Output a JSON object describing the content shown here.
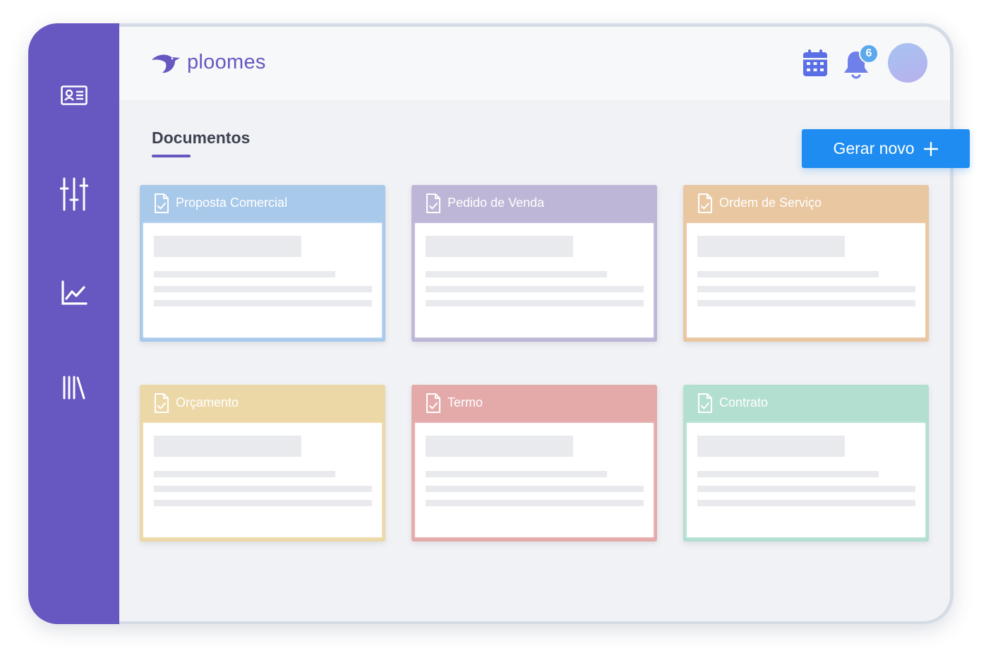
{
  "app": {
    "logo_text": "ploomes"
  },
  "header": {
    "notification_count": "6"
  },
  "page": {
    "title": "Documentos"
  },
  "actions": {
    "new_label": "Gerar novo",
    "new_icon": "plus-icon"
  },
  "sidebar": {
    "items": [
      {
        "icon": "contact-card-icon"
      },
      {
        "icon": "sliders-icon"
      },
      {
        "icon": "chart-line-icon"
      },
      {
        "icon": "library-icon"
      }
    ]
  },
  "cards": [
    {
      "title": "Proposta Comercial",
      "color": "#a9c9ea",
      "border": "#b7d2f0"
    },
    {
      "title": "Pedido de Venda",
      "color": "#bdb6d6",
      "border": "#c4bedd"
    },
    {
      "title": "Ordem de Serviço",
      "color": "#e8c7a1",
      "border": "#ecc9a7"
    },
    {
      "title": "Orçamento",
      "color": "#ecd8a7",
      "border": "#efdcae"
    },
    {
      "title": "Termo",
      "color": "#e4aaaa",
      "border": "#e8b3b3"
    },
    {
      "title": "Contrato",
      "color": "#b2dfd0",
      "border": "#bfe4d7"
    }
  ],
  "colors": {
    "sidebar": "#6757c0",
    "accent": "#1e8cf0",
    "icon_blue": "#5a6ee6"
  }
}
